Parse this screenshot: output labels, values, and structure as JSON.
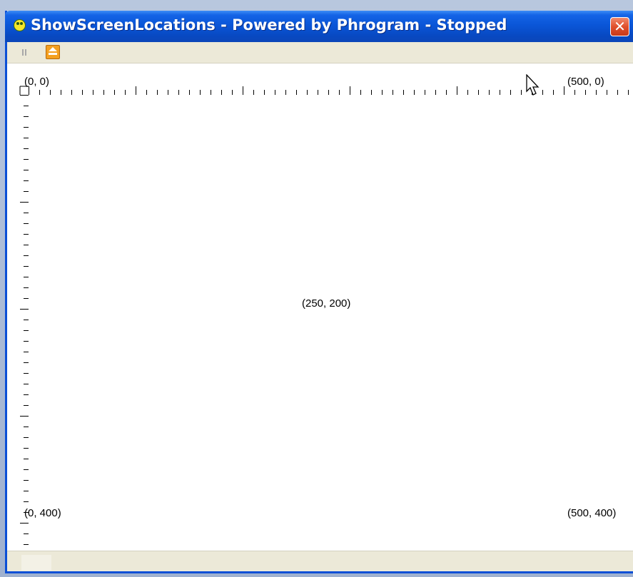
{
  "window": {
    "title": "ShowScreenLocations - Powered by Phrogram - Stopped",
    "close_label": "✕",
    "accent_color": "#0a56d8",
    "close_color": "#e0502c"
  },
  "toolbar": {
    "pause_icon": "pause-icon",
    "eject_icon": "eject-icon"
  },
  "canvas": {
    "labels": {
      "top_left": "(0, 0)",
      "top_right": "(500, 0)",
      "center": "(250, 200)",
      "bottom_left": "(0, 400)",
      "bottom_right": "(500, 400)"
    }
  },
  "status_bar": {
    "text": ""
  }
}
